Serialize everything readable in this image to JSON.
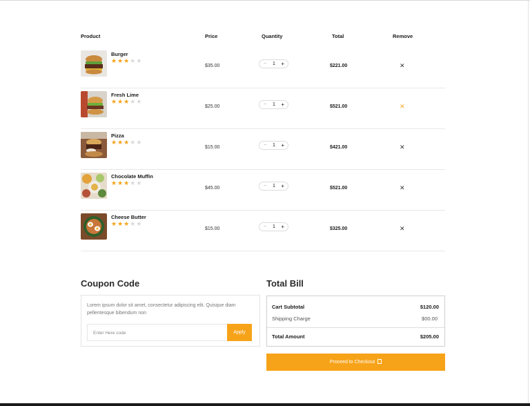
{
  "table": {
    "headers": {
      "product": "Product",
      "price": "Price",
      "quantity": "Quantity",
      "total": "Total",
      "remove": "Remove"
    },
    "rows": [
      {
        "name": "Burger",
        "price": "$35.00",
        "qty": "1",
        "total": "$221.00",
        "rating": 3,
        "image": "burger-image"
      },
      {
        "name": "Fresh Lime",
        "price": "$25.00",
        "qty": "1",
        "total": "$521.00",
        "rating": 3,
        "image": "fresh-lime-image"
      },
      {
        "name": "Pizza",
        "price": "$15.00",
        "qty": "1",
        "total": "$421.00",
        "rating": 3,
        "image": "pizza-image"
      },
      {
        "name": "Chocolate Muffin",
        "price": "$45.00",
        "qty": "1",
        "total": "$521.00",
        "rating": 3,
        "image": "chocolate-muffin-image"
      },
      {
        "name": "Cheese Butter",
        "price": "$15.00",
        "qty": "1",
        "total": "$325.00",
        "rating": 3,
        "image": "cheese-butter-image"
      }
    ],
    "minus_symbol": "−",
    "plus_symbol": "+",
    "remove_symbol": "✕",
    "star_symbol": "★"
  },
  "coupon": {
    "title": "Coupon Code",
    "text": "Lorem ipsum dolor sit amet, consectetur adipiscing elit. Quisque diam pellentesque bibendum non",
    "placeholder": "Enter Here code",
    "apply_label": "Apply"
  },
  "bill": {
    "title": "Total Bill",
    "subtotal_label": "Cart Subtotal",
    "subtotal_value": "$120.00",
    "shipping_label": "Shipping Charge",
    "shipping_value": "$00.00",
    "total_label": "Total Amount",
    "total_value": "$205.00",
    "checkout_label": "Proceed to Checkout"
  },
  "colors": {
    "accent": "#f7a319",
    "star_off": "#d9d9d9",
    "text": "#1a1a1a"
  }
}
